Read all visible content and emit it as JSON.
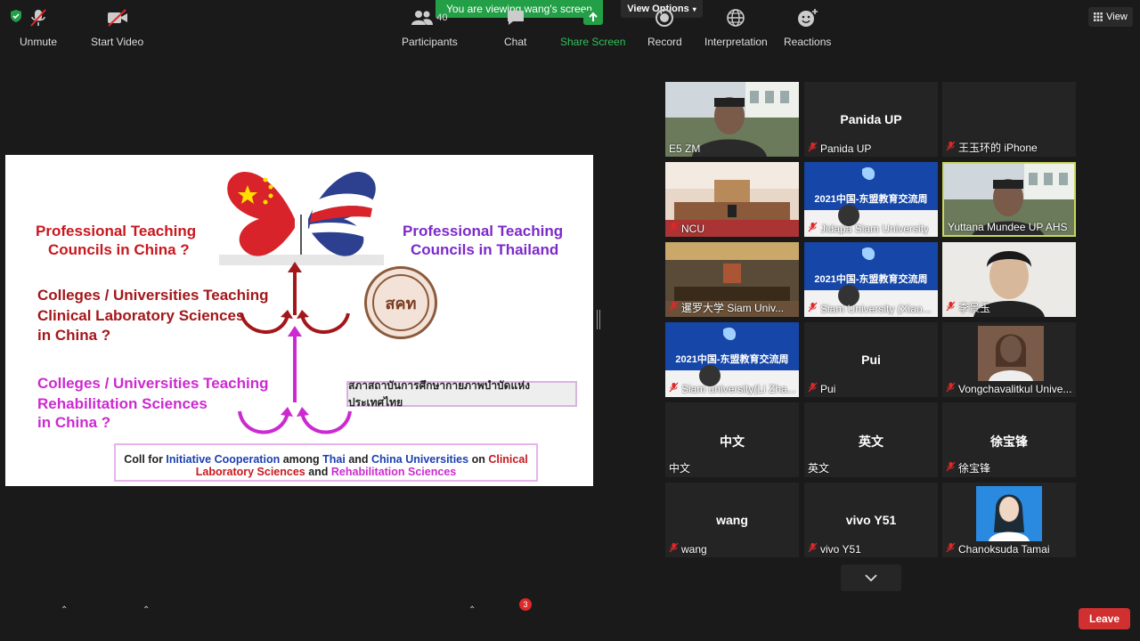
{
  "header": {
    "banner_text": "You are viewing wang's screen",
    "view_options_label": "View Options",
    "view_label": "View"
  },
  "slide": {
    "left_top_title_1": "Professional Teaching",
    "left_top_title_2": "Councils in China ?",
    "right_top_title_1": "Professional Teaching",
    "right_top_title_2": "Councils in Thailand",
    "mid_left_1": "Colleges / Universities Teaching",
    "mid_left_2": "Clinical Laboratory Sciences",
    "mid_left_3": "in China ?",
    "seal_text": "สคท",
    "low_left_1": "Colleges / Universities Teaching",
    "low_left_2": "Rehabilitation Sciences",
    "low_left_3": "in China ?",
    "thai_box": "สภาสถาบันการศึกษากายภาพบำบัดแห่งประเทศไทย",
    "bottom_1": {
      "a": "Coll for ",
      "b": "Initiative Cooperation",
      "c": " among ",
      "d": "Thai",
      "e": " and ",
      "f": "China Universities",
      "g": " on ",
      "h": "Clinical"
    },
    "bottom_2": {
      "a": "Laboratory Sciences",
      "b": " and ",
      "c": "Rehabilitation Sciences"
    }
  },
  "participants_grid": [
    {
      "label": "E5 ZM",
      "center": "",
      "type": "video-office",
      "muted": false
    },
    {
      "label": "Panida UP",
      "center": "Panida UP",
      "type": "name",
      "muted": true
    },
    {
      "label": "王玉环的 iPhone",
      "center": "",
      "type": "blank",
      "muted": true
    },
    {
      "label": "NCU",
      "center": "",
      "type": "video-room",
      "muted": true
    },
    {
      "label": "Jidapa Siam University",
      "center": "",
      "type": "video-banner",
      "muted": true
    },
    {
      "label": "Yuttana Mundee UP AHS",
      "center": "",
      "type": "video-office",
      "muted": false
    },
    {
      "label": "暹罗大学 Siam Univ...",
      "center": "",
      "type": "video-hall",
      "muted": true
    },
    {
      "label": "Siam University (Xiao...",
      "center": "",
      "type": "video-banner",
      "muted": true
    },
    {
      "label": "李景玉",
      "center": "",
      "type": "video-person",
      "muted": true
    },
    {
      "label": "Siam university(Li Zha...",
      "center": "",
      "type": "video-banner",
      "muted": true
    },
    {
      "label": "Pui",
      "center": "Pui",
      "type": "name",
      "muted": true
    },
    {
      "label": "Vongchavalitkul Unive...",
      "center": "",
      "type": "photo-woman",
      "muted": true
    },
    {
      "label": "中文",
      "center": "中文",
      "type": "name",
      "muted": false
    },
    {
      "label": "英文",
      "center": "英文",
      "type": "name",
      "muted": false
    },
    {
      "label": "徐宝锋",
      "center": "徐宝锋",
      "type": "name",
      "muted": true
    },
    {
      "label": "wang",
      "center": "wang",
      "type": "name",
      "muted": true
    },
    {
      "label": "vivo Y51",
      "center": "vivo Y51",
      "type": "name",
      "muted": true
    },
    {
      "label": "Chanoksuda Tamai",
      "center": "",
      "type": "photo-woman2",
      "muted": true
    }
  ],
  "banner_tile_text": "2021中国-东盟教育交流周",
  "toolbar": {
    "unmute": "Unmute",
    "start_video": "Start Video",
    "participants": "Participants",
    "participants_count": "40",
    "chat": "Chat",
    "chat_badge": "3",
    "share_screen": "Share Screen",
    "record": "Record",
    "interpretation": "Interpretation",
    "reactions": "Reactions",
    "leave": "Leave"
  },
  "colors": {
    "share_green": "#23a047",
    "leave_red": "#d03030",
    "active_border": "#c7d85b"
  }
}
